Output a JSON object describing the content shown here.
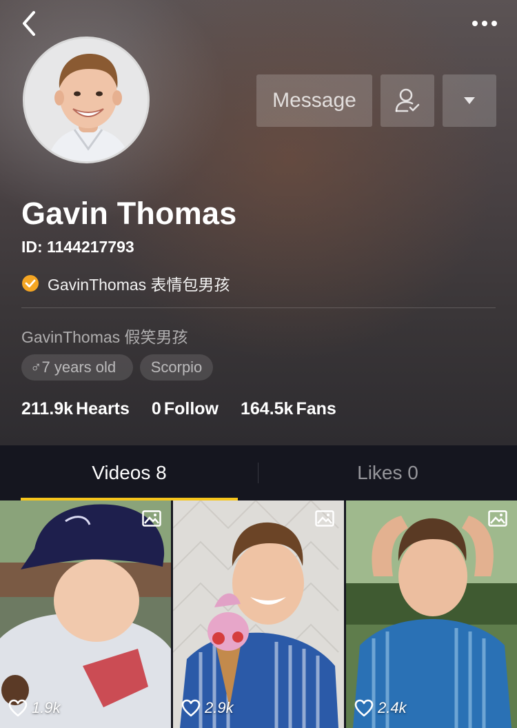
{
  "profile": {
    "name": "Gavin Thomas",
    "id_text": "ID: 1144217793",
    "verified_text": "GavinThomas 表情包男孩",
    "bio": "GavinThomas 假笑男孩",
    "tags": {
      "age": "7 years old",
      "age_symbol": "♂",
      "zodiac": "Scorpio"
    }
  },
  "actions": {
    "message_label": "Message",
    "follow_icon": "user-check-icon",
    "dropdown_icon": "caret-down-icon"
  },
  "stats": {
    "hearts_value": "211.9k",
    "hearts_label": "Hearts",
    "follow_value": "0",
    "follow_label": "Follow",
    "fans_value": "164.5k",
    "fans_label": "Fans"
  },
  "tabs": {
    "videos": "Videos 8",
    "likes": "Likes 0",
    "active": "videos",
    "accent_color": "#f6c51c"
  },
  "videos": [
    {
      "likes": "1.9k"
    },
    {
      "likes": "2.9k"
    },
    {
      "likes": "2.4k"
    }
  ]
}
